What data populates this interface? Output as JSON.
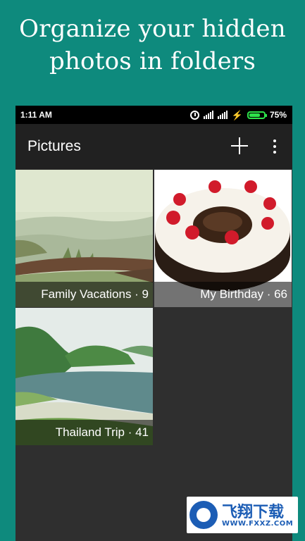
{
  "headline": {
    "line1": "Organize your hidden",
    "line2": "photos in folders"
  },
  "status_bar": {
    "time": "1:11 AM",
    "battery": "75%",
    "battery_level": 0.75
  },
  "app_bar": {
    "title": "Pictures",
    "add_icon": "plus-icon",
    "more_icon": "more-vert-icon"
  },
  "folders": [
    {
      "name": "Family Vacations",
      "count": "9",
      "label": "Family Vacations · 9"
    },
    {
      "name": "My Birthday",
      "count": "66",
      "label": "My Birthday · 66"
    },
    {
      "name": "Thailand Trip",
      "count": "41",
      "label": "Thailand Trip · 41"
    }
  ],
  "watermark": {
    "site": "飞翔下载",
    "url": "WWW.FXXZ.COM"
  },
  "colors": {
    "background": "#0e8a7d",
    "screen": "#2f2f2f",
    "toolbar": "#212121",
    "battery": "#2ee24a"
  }
}
